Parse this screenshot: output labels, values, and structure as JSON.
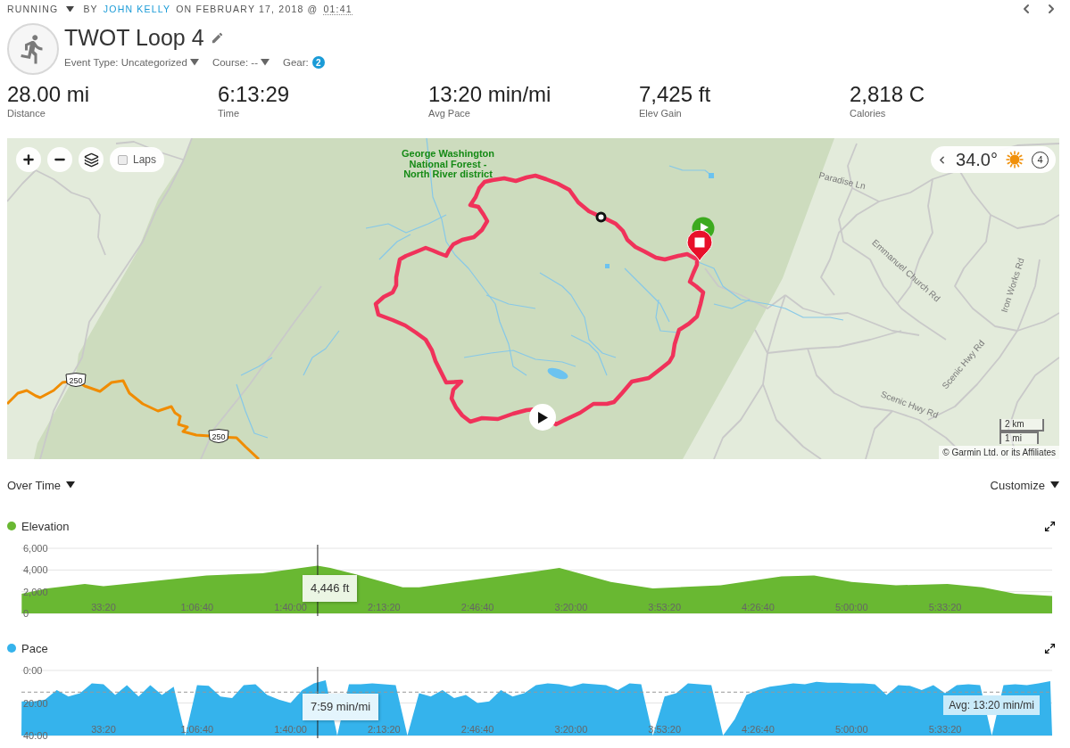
{
  "breadcrumb": {
    "activity_type": "RUNNING",
    "by": "BY",
    "author": "JOHN KELLY",
    "date": "ON FEBRUARY 17, 2018 @",
    "time": "01:41"
  },
  "activity": {
    "title": "TWOT Loop 4",
    "event_type": "Event Type: Uncategorized",
    "course": "Course: --",
    "gear_label": "Gear:",
    "gear_count": "2"
  },
  "stats": [
    {
      "value": "28.00 mi",
      "label": "Distance"
    },
    {
      "value": "6:13:29",
      "label": "Time"
    },
    {
      "value": "13:20 min/mi",
      "label": "Avg Pace"
    },
    {
      "value": "7,425 ft",
      "label": "Elev Gain"
    },
    {
      "value": "2,818 C",
      "label": "Calories"
    }
  ],
  "map": {
    "laps": {
      "label": "Laps",
      "checked": false
    },
    "weather": {
      "temperature": "34.0°",
      "wind": "4"
    },
    "area_label": [
      "George Washington",
      "National Forest -",
      "North River district"
    ],
    "road_labels": [
      "Paradise Ln",
      "Emmanuel Church Rd",
      "Iron Works Rd",
      "Scenic Hwy Rd",
      "Scenic Hwy Rd"
    ],
    "route_shields": [
      "250",
      "250"
    ],
    "scale": {
      "metric": "2 km",
      "imperial": "1 mi"
    },
    "attribution": "© Garmin Ltd. or its Affiliates"
  },
  "charts_toolbar": {
    "view": "Over Time",
    "customize": "Customize"
  },
  "charts": [
    {
      "chart_data": {
        "type": "area",
        "xlim": [
          244,
          22290
        ],
        "ylim": [
          0,
          6000
        ],
        "yticks": [
          {
            "value": 0,
            "label": "0"
          },
          {
            "value": 2000,
            "label": "2,000"
          },
          {
            "value": 4000,
            "label": "4,000"
          },
          {
            "value": 6000,
            "label": "6,000"
          }
        ],
        "xticks": [
          {
            "value": 2000,
            "label": "33:20"
          },
          {
            "value": 4000,
            "label": "1:06:40"
          },
          {
            "value": 6000,
            "label": "1:40:00"
          },
          {
            "value": 8000,
            "label": "2:13:20"
          },
          {
            "value": 10000,
            "label": "2:46:40"
          },
          {
            "value": 12000,
            "label": "3:20:00"
          },
          {
            "value": 14000,
            "label": "3:53:20"
          },
          {
            "value": 16000,
            "label": "4:26:40"
          },
          {
            "value": 18000,
            "label": "5:00:00"
          },
          {
            "value": 20000,
            "label": "5:33:20"
          }
        ],
        "x": [
          250,
          800,
          1600,
          2000,
          2900,
          4200,
          5400,
          6400,
          6580,
          6850,
          7400,
          8400,
          8750,
          11300,
          11750,
          12850,
          13750,
          15200,
          16500,
          17200,
          18000,
          18950,
          20050,
          20800,
          21500,
          22290
        ],
        "series": [
          {
            "name": "Elevation",
            "color": "#69b832",
            "values": [
              1800,
              2300,
              2700,
              2500,
              2900,
              3500,
              3700,
              4300,
              4400,
              4200,
              3600,
              2400,
              2400,
              3900,
              4200,
              2900,
              2300,
              2600,
              3400,
              3500,
              2900,
              2600,
              2700,
              2400,
              1800,
              1600
            ]
          }
        ],
        "ref_lines": [
          {
            "axis": "x",
            "value": 6580
          }
        ],
        "annotations": [
          {
            "text": "4,446 ft",
            "x": 6580,
            "y": 4446
          }
        ]
      }
    },
    {
      "chart_data": {
        "type": "area",
        "xlim": [
          244,
          22290
        ],
        "ylim": [
          40,
          0
        ],
        "yticks": [
          {
            "value": 0,
            "label": "0:00"
          },
          {
            "value": 20,
            "label": "20:00"
          },
          {
            "value": 40,
            "label": "40:00"
          }
        ],
        "xticks": [
          {
            "value": 2000,
            "label": "33:20"
          },
          {
            "value": 4000,
            "label": "1:06:40"
          },
          {
            "value": 6000,
            "label": "1:40:00"
          },
          {
            "value": 8000,
            "label": "2:13:20"
          },
          {
            "value": 10000,
            "label": "2:46:40"
          },
          {
            "value": 12000,
            "label": "3:20:00"
          },
          {
            "value": 14000,
            "label": "3:53:20"
          },
          {
            "value": 16000,
            "label": "4:26:40"
          },
          {
            "value": 18000,
            "label": "5:00:00"
          },
          {
            "value": 20000,
            "label": "5:33:20"
          }
        ],
        "x": [
          244,
          250,
          500,
          750,
          1000,
          1250,
          1500,
          1750,
          2000,
          2250,
          2500,
          2750,
          3000,
          3250,
          3500,
          3750,
          4000,
          4250,
          4500,
          4750,
          5000,
          5250,
          5500,
          5750,
          6000,
          6250,
          6500,
          6750,
          7000,
          7250,
          7500,
          7750,
          8000,
          8250,
          8500,
          8750,
          9000,
          9250,
          9500,
          9750,
          10000,
          10250,
          10500,
          10750,
          11000,
          11250,
          11500,
          11750,
          12000,
          12250,
          12500,
          12750,
          13000,
          13250,
          13500,
          13750,
          14000,
          14250,
          14500,
          14750,
          15000,
          15250,
          15500,
          15750,
          16000,
          16250,
          16500,
          16750,
          17000,
          17250,
          17500,
          17750,
          18000,
          18250,
          18500,
          18750,
          19000,
          19250,
          19500,
          19750,
          20000,
          20250,
          20500,
          20750,
          21000,
          21250,
          21500,
          21750,
          22000,
          22250,
          22290
        ],
        "series": [
          {
            "name": "Pace",
            "color": "#35b3ec",
            "values": [
              40,
              19,
              19,
              18,
              12,
              16,
              14,
              8,
              8.5,
              15,
              9,
              16,
              9,
              15,
              10,
              40,
              9,
              9.5,
              16,
              17,
              9,
              8.5,
              15,
              18,
              20,
              12,
              8,
              6,
              40,
              8.5,
              8.5,
              8,
              8.5,
              9,
              40,
              14,
              16,
              12,
              17,
              15,
              20,
              19,
              12,
              16,
              14,
              9,
              8,
              8.5,
              10,
              8,
              8.5,
              9,
              12,
              8,
              8.5,
              40,
              16,
              14,
              8,
              8.5,
              9,
              40,
              30,
              15,
              12,
              10,
              9,
              8,
              8.5,
              7,
              7.5,
              7.5,
              8,
              8,
              8.5,
              15,
              9,
              9.5,
              12,
              9,
              14,
              9,
              8.5,
              9,
              40,
              9,
              8.5,
              9,
              8,
              6.5,
              40
            ]
          }
        ],
        "ref_lines": [
          {
            "axis": "x",
            "value": 6580
          },
          {
            "axis": "y",
            "value": 13.33,
            "label": "Avg: 13:20 min/mi"
          }
        ],
        "annotations": [
          {
            "text": "7:59 min/mi",
            "x": 6580,
            "y": 8
          }
        ]
      }
    }
  ]
}
